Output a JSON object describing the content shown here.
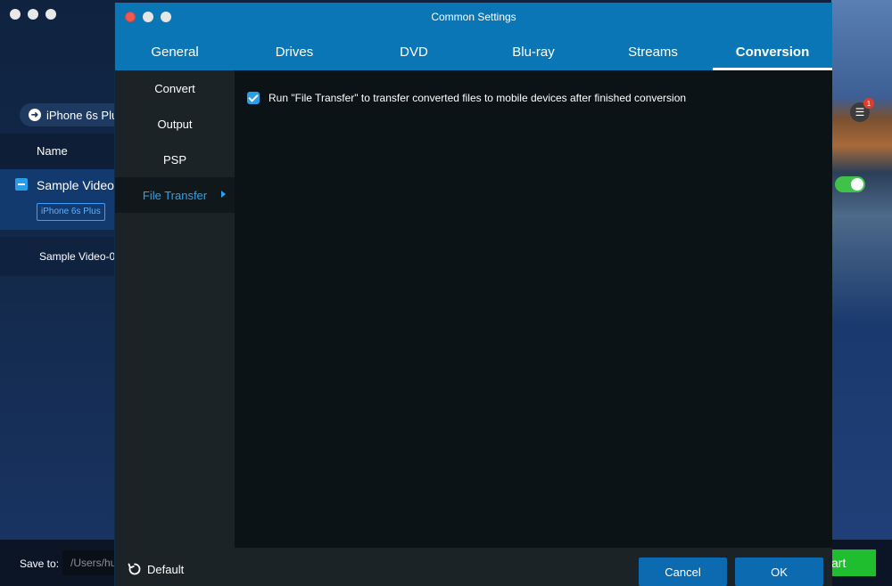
{
  "background_app": {
    "device_button_label": "iPhone 6s Plus",
    "name_column": "Name",
    "row1_title": "Sample Video-",
    "row1_chip": "iPhone 6s Plus",
    "row2_title": "Sample Video-0",
    "save_to_label": "Save to:",
    "save_path": "/Users/hu",
    "start_button_label": "art",
    "badge_count": "1"
  },
  "dialog": {
    "title": "Common Settings",
    "tabs": [
      {
        "label": "General"
      },
      {
        "label": "Drives"
      },
      {
        "label": "DVD"
      },
      {
        "label": "Blu-ray"
      },
      {
        "label": "Streams"
      },
      {
        "label": "Conversion",
        "active": true
      }
    ],
    "sidebar": {
      "items": [
        {
          "label": "Convert"
        },
        {
          "label": "Output"
        },
        {
          "label": "PSP"
        },
        {
          "label": "File Transfer",
          "active": true
        }
      ]
    },
    "content": {
      "file_transfer_option": {
        "label": "Run \"File Transfer\" to transfer converted files to mobile devices after finished conversion",
        "checked": true
      }
    },
    "footer": {
      "default_label": "Default",
      "cancel_label": "Cancel",
      "ok_label": "OK"
    }
  },
  "colors": {
    "accent": "#0b76b5",
    "active_text": "#2aa3f0",
    "button": "#0b6ab0",
    "start_green": "#1fbe2f"
  }
}
